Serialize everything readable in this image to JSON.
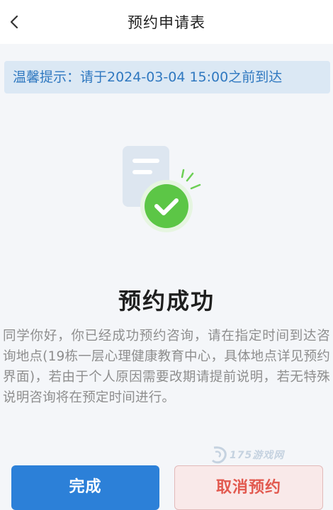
{
  "header": {
    "title": "预约申请表",
    "back_icon": "chevron-left-icon"
  },
  "notice": {
    "text": "温馨提示：请于2024-03-04 15:00之前到达"
  },
  "result": {
    "illustration_icon": "document-check-icon",
    "title": "预约成功",
    "message": "同学你好，你已经成功预约咨询，请在指定时间到达咨询地点(19栋一层心理健康教育中心，具体地点详见预约界面)，若由于个人原因需要改期请提前说明，若无特殊说明咨询将在预定时间进行。"
  },
  "watermark": {
    "text": "175游戏网"
  },
  "actions": {
    "done_label": "完成",
    "cancel_label": "取消预约"
  },
  "colors": {
    "accent_blue": "#2c80d8",
    "notice_text": "#2f78c0",
    "notice_bg": "#dbe8f4",
    "success_green": "#5cc646",
    "cancel_text": "#e2594f",
    "cancel_bg": "#f9e9e9"
  }
}
